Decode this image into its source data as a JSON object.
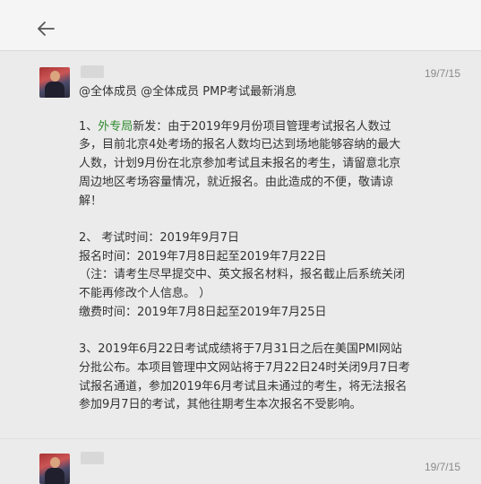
{
  "message1": {
    "timestamp": "19/7/15",
    "header": "@全体成员 @全体成员 PMP考试最新消息",
    "p1_prefix": "1、",
    "p1_link": "外专局",
    "p1_rest": "新发：由于2019年9月份项目管理考试报名人数过多，目前北京4处考场的报名人数均已达到场地能够容纳的最大人数，计划9月份在北京参加考试且未报名的考生，请留意北京周边地区考场容量情况，就近报名。由此造成的不便，敬请谅解！",
    "p2_line1": "2、 考试时间：2019年9月7日",
    "p2_line2": "报名时间：2019年7月8日起至2019年7月22日",
    "p2_line3": "（注：请考生尽早提交中、英文报名材料，报名截止后系统关闭不能再修改个人信息。 ）",
    "p2_line4": "缴费时间：2019年7月8日起至2019年7月25日",
    "p3": "3、2019年6月22日考试成绩将于7月31日之后在美国PMI网站分批公布。本项目管理中文网站将于7月22日24时关闭9月7日考试报名通道，参加2019年6月考试且未通过的考生，将无法报名参加9月7日的考试，其他往期考生本次报名不受影响。"
  },
  "message2": {
    "timestamp": "19/7/15"
  }
}
